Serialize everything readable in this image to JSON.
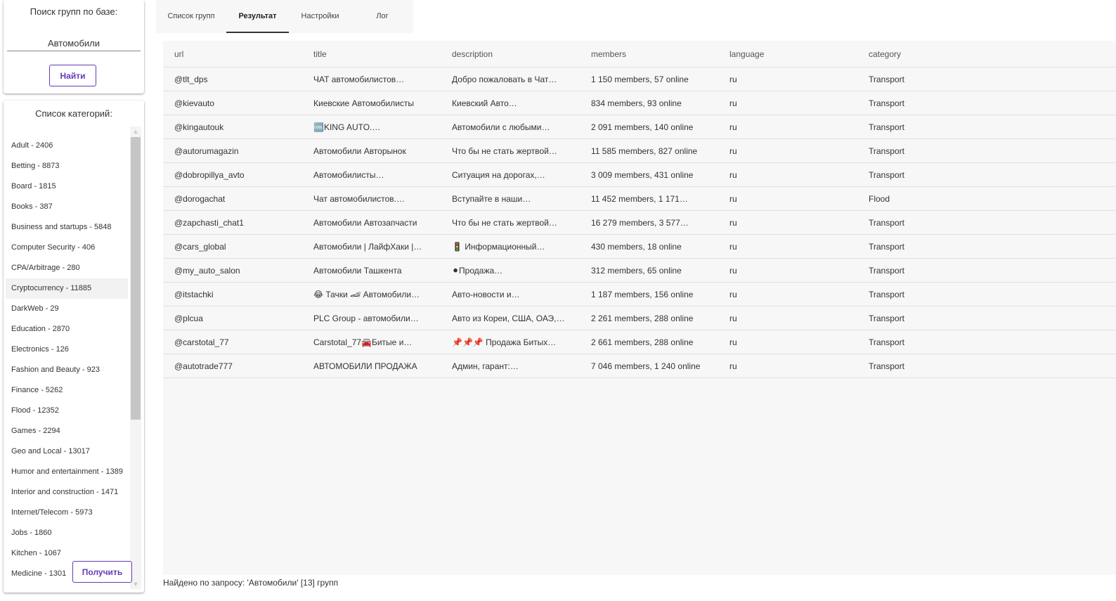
{
  "search": {
    "title": "Поиск групп по базе:",
    "query": "Автомобили",
    "find_label": "Найти"
  },
  "categories": {
    "title": "Список категорий:",
    "get_label": "Получить",
    "items": [
      "Adult - 2406",
      "Betting - 8873",
      "Board - 1815",
      "Books - 387",
      "Business and startups - 5848",
      "Computer Security - 406",
      "CPA/Arbitrage - 280",
      "Cryptocurrency - 11885",
      "DarkWeb - 29",
      "Education - 2870",
      "Electronics - 126",
      "Fashion and Beauty - 923",
      "Finance - 5262",
      "Flood - 12352",
      "Games - 2294",
      "Geo and Local - 13017",
      "Humor and entertainment - 1389",
      "Interior and construction - 1471",
      "Internet/Telecom - 5973",
      "Jobs - 1860",
      "Kitchen - 1067",
      "Medicine - 1301"
    ]
  },
  "tabs": [
    "Список групп",
    "Результат",
    "Настройки",
    "Лог"
  ],
  "table": {
    "columns": [
      "url",
      "title",
      "description",
      "members",
      "language",
      "category"
    ],
    "rows": [
      [
        "@tlt_dps",
        "ЧАТ автомобилистов…",
        "Добро пожаловать в Чат…",
        "1 150 members, 57 online",
        "ru",
        "Transport"
      ],
      [
        "@kievauto",
        "Киевские Автомобилисты",
        "Киевский Авто…",
        "834 members, 93 online",
        "ru",
        "Transport"
      ],
      [
        "@kingautouk",
        "🆒KING AUTO.…",
        "Автомобили с любыми…",
        "2 091 members, 140 online",
        "ru",
        "Transport"
      ],
      [
        "@autorumagazin",
        "Автомобили Авторынок",
        "Что бы не стать жертвой…",
        "11 585 members, 827 online",
        "ru",
        "Transport"
      ],
      [
        "@dobropillya_avto",
        "Автомобилисты…",
        "Ситуация на дорогах,…",
        "3 009 members, 431 online",
        "ru",
        "Transport"
      ],
      [
        "@dorogachat",
        "Чат автомобилистов.…",
        "Вступайте в наши…",
        "11 452 members, 1 171…",
        "ru",
        "Flood"
      ],
      [
        "@zapchasti_chat1",
        "Автомобили Автозапчасти",
        "Что бы не стать жертвой…",
        "16 279 members, 3 577…",
        "ru",
        "Transport"
      ],
      [
        "@cars_global",
        "Автомобили | ЛайфХаки |…",
        "🚦 Информационный…",
        "430 members, 18 online",
        "ru",
        "Transport"
      ],
      [
        "@my_auto_salon",
        "Автомобили Ташкента",
        "⚫Продажа…",
        "312 members, 65 online",
        "ru",
        "Transport"
      ],
      [
        "@itstachki",
        "😂 Тачки 🏎 Автомобили…",
        "Авто-новости и…",
        "1 187 members, 156 online",
        "ru",
        "Transport"
      ],
      [
        "@plcua",
        "PLC Group - автомобили…",
        "Авто из Кореи, США, ОАЭ,…",
        "2 261 members, 288 online",
        "ru",
        "Transport"
      ],
      [
        "@carstotal_77",
        "Carstotal_77🚘Битые и…",
        "📌📌📌 Продажа Битых…",
        "2 661 members, 288 online",
        "ru",
        "Transport"
      ],
      [
        "@autotrade777",
        "АВТОМОБИЛИ ПРОДАЖА",
        "Админ, гарант:…",
        "7 046 members, 1 240 online",
        "ru",
        "Transport"
      ]
    ]
  },
  "status": "Найдено по запросу: 'Автомобили' [13] групп",
  "colors": {
    "accent": "#673ab7",
    "panel_bg": "#f7f7f7"
  }
}
